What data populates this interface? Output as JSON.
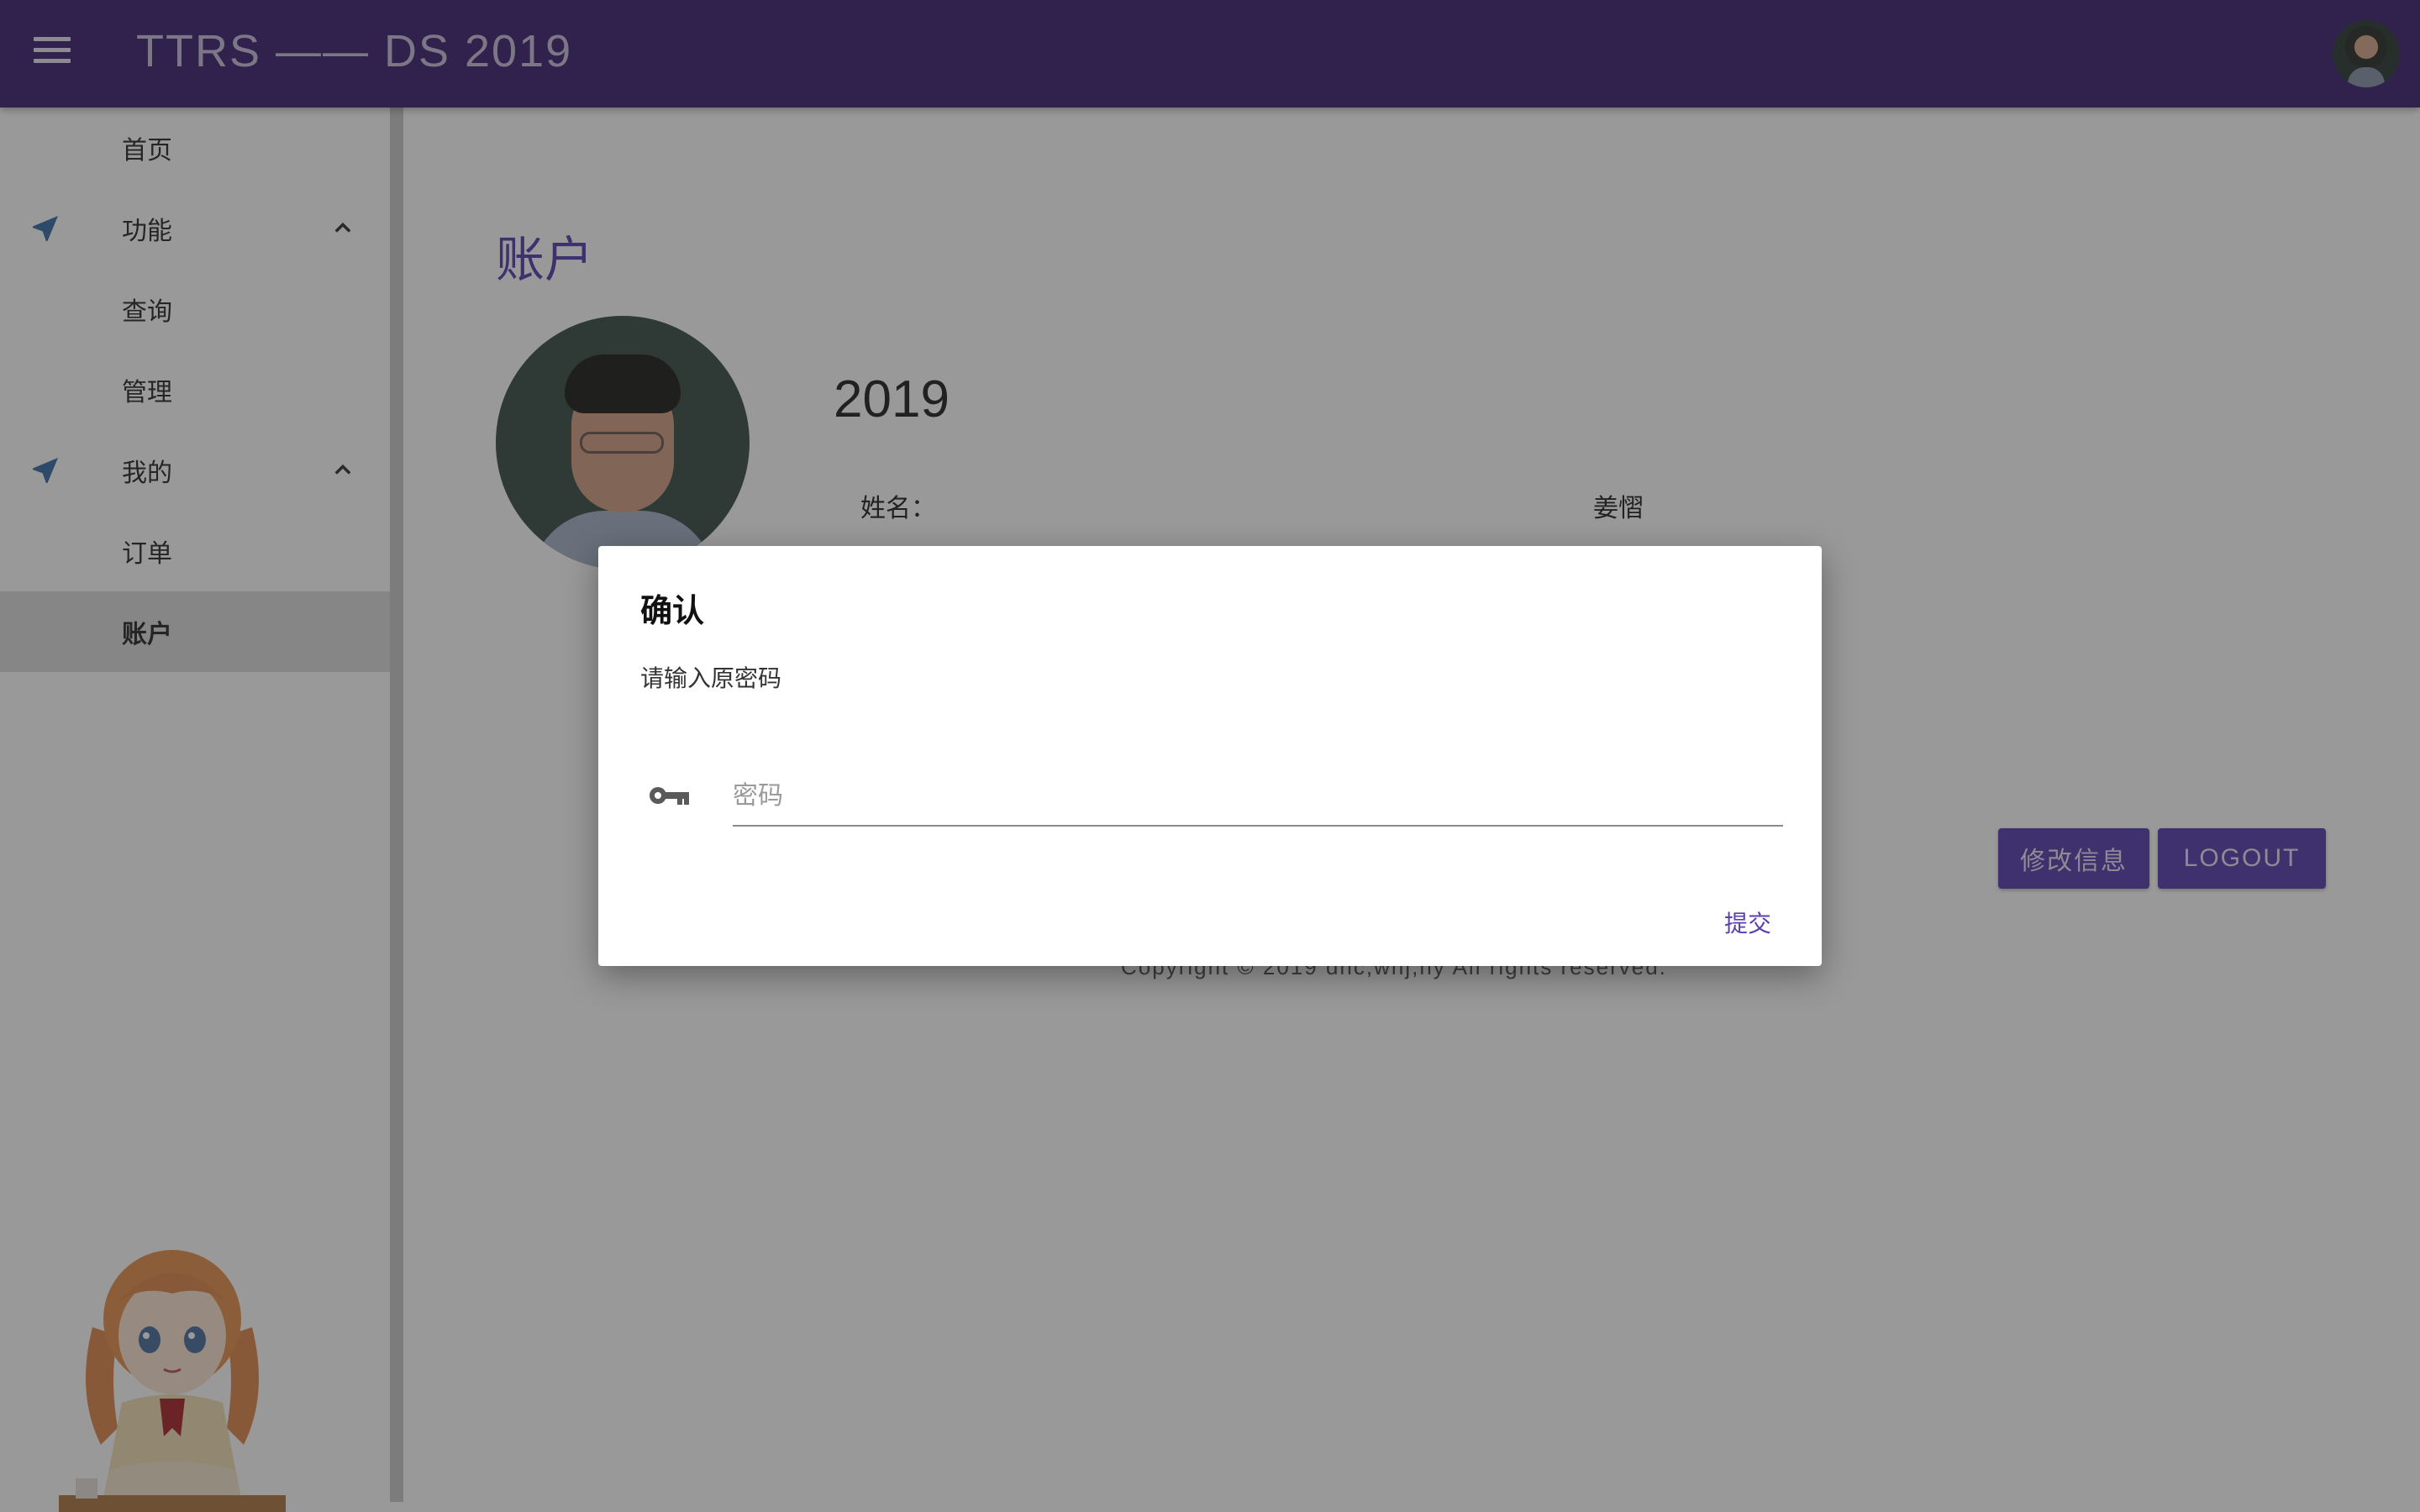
{
  "app": {
    "title": "TTRS —— DS 2019"
  },
  "sidebar": {
    "items": [
      {
        "label": "首页"
      },
      {
        "label": "功能",
        "expanded": true
      },
      {
        "label": "查询"
      },
      {
        "label": "管理"
      },
      {
        "label": "我的",
        "expanded": true
      },
      {
        "label": "订单"
      },
      {
        "label": "账户",
        "active": true
      }
    ]
  },
  "account": {
    "page_title": "账户",
    "username": "2019",
    "name_label": "姓名：",
    "name_value": "姜慴",
    "edit_button": "修改信息",
    "logout_button": "LOGOUT"
  },
  "footer": {
    "copyright": "Copyright © 2019 dnc,whj,hy All rights reserved."
  },
  "dialog": {
    "title": "确认",
    "message": "请输入原密码",
    "password_placeholder": "密码",
    "password_value": "",
    "submit_label": "提交"
  },
  "colors": {
    "appbar": "#3d2473",
    "accent": "#5a3fb0",
    "overlay": "rgba(33,33,33,0.46)"
  },
  "icons": {
    "menu": "menu-icon",
    "nav": "navigation-arrow-icon",
    "chevron": "chevron-up-icon",
    "key": "key-icon"
  }
}
